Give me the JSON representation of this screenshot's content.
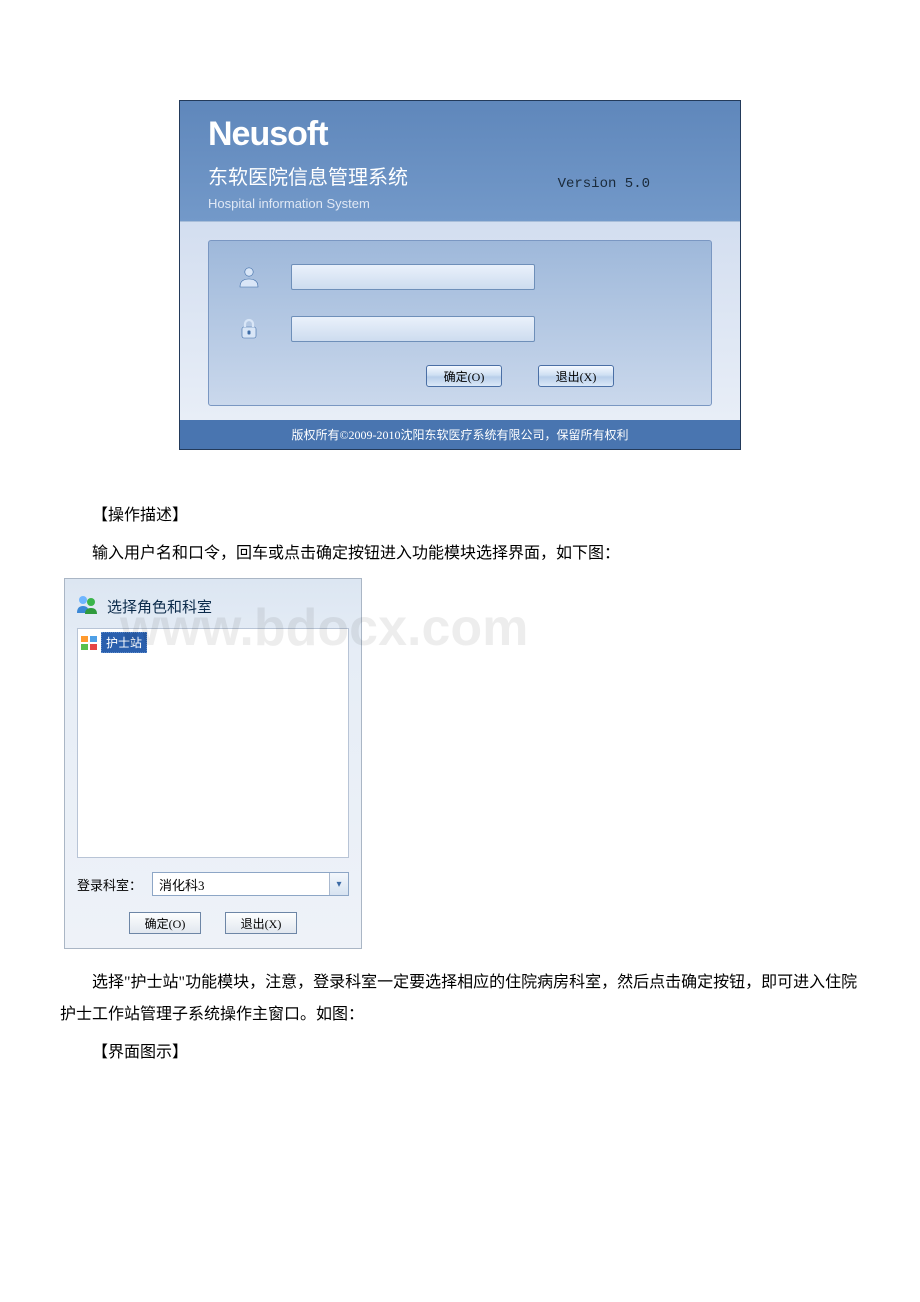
{
  "login": {
    "logo": "Neusoft",
    "title": "东软医院信息管理系统",
    "subtitle": "Hospital information System",
    "version": "Version 5.0",
    "username": "",
    "password": "",
    "ok_label": "确定(O)",
    "exit_label": "退出(X)",
    "copyright": "版权所有©2009-2010沈阳东软医疗系统有限公司，保留所有权利"
  },
  "text": {
    "op_heading": "【操作描述】",
    "op_desc": "输入用户名和口令，回车或点击确定按钮进入功能模块选择界面，如下图：",
    "after_role": "选择\"护士站\"功能模块，注意，登录科室一定要选择相应的住院病房科室，然后点击确定按钮，即可进入住院护士工作站管理子系统操作主窗口。如图：",
    "ui_heading": "【界面图示】"
  },
  "role": {
    "title": "选择角色和科室",
    "items": [
      "护士站"
    ],
    "dept_label": "登录科室：",
    "dept_value": "消化科3",
    "ok_label": "确定(O)",
    "exit_label": "退出(X)"
  },
  "watermark": "www.bdocx.com"
}
